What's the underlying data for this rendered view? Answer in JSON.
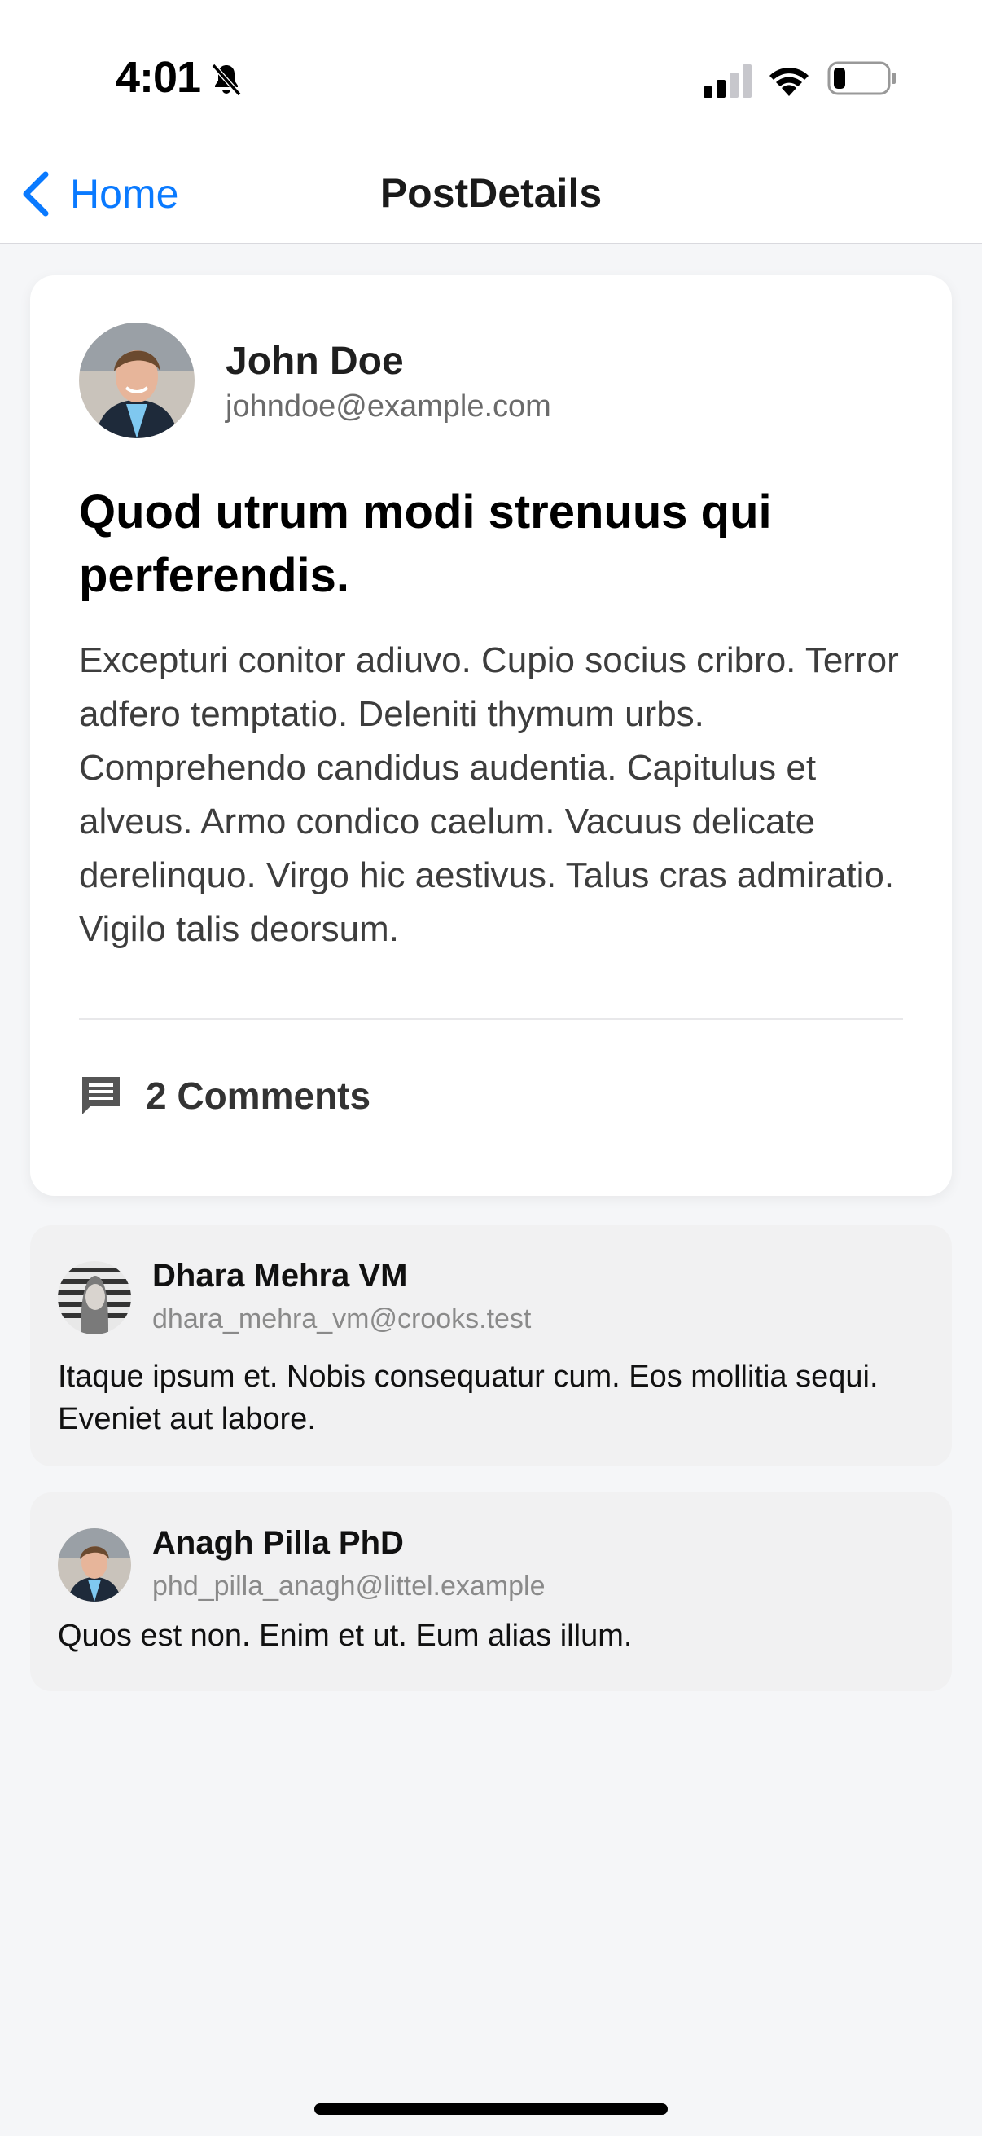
{
  "status_bar": {
    "time": "4:01",
    "icons": [
      "bell-slash-icon",
      "signal-icon",
      "wifi-icon",
      "battery-icon"
    ]
  },
  "nav": {
    "back_label": "Home",
    "title": "PostDetails",
    "accent_color": "#0a7aff"
  },
  "post": {
    "author_name": "John Doe",
    "author_email": "johndoe@example.com",
    "title": "Quod utrum modi strenuus qui perferendis.",
    "body": "Excepturi conitor adiuvo. Cupio socius cribro. Terror adfero temptatio. Deleniti thymum urbs. Comprehendo candidus audentia. Capitulus et alveus. Armo condico caelum. Vacuus delicate derelinquo. Virgo hic aestivus. Talus cras admiratio. Vigilo talis deorsum.",
    "comments_count_label": "2 Comments"
  },
  "comments": [
    {
      "name": "Dhara Mehra VM",
      "email": "dhara_mehra_vm@crooks.test",
      "text": "Itaque ipsum et. Nobis consequatur cum. Eos mollitia sequi. Eveniet aut labore."
    },
    {
      "name": "Anagh Pilla PhD",
      "email": "phd_pilla_anagh@littel.example",
      "text": "Quos est non. Enim et ut. Eum alias illum."
    }
  ]
}
